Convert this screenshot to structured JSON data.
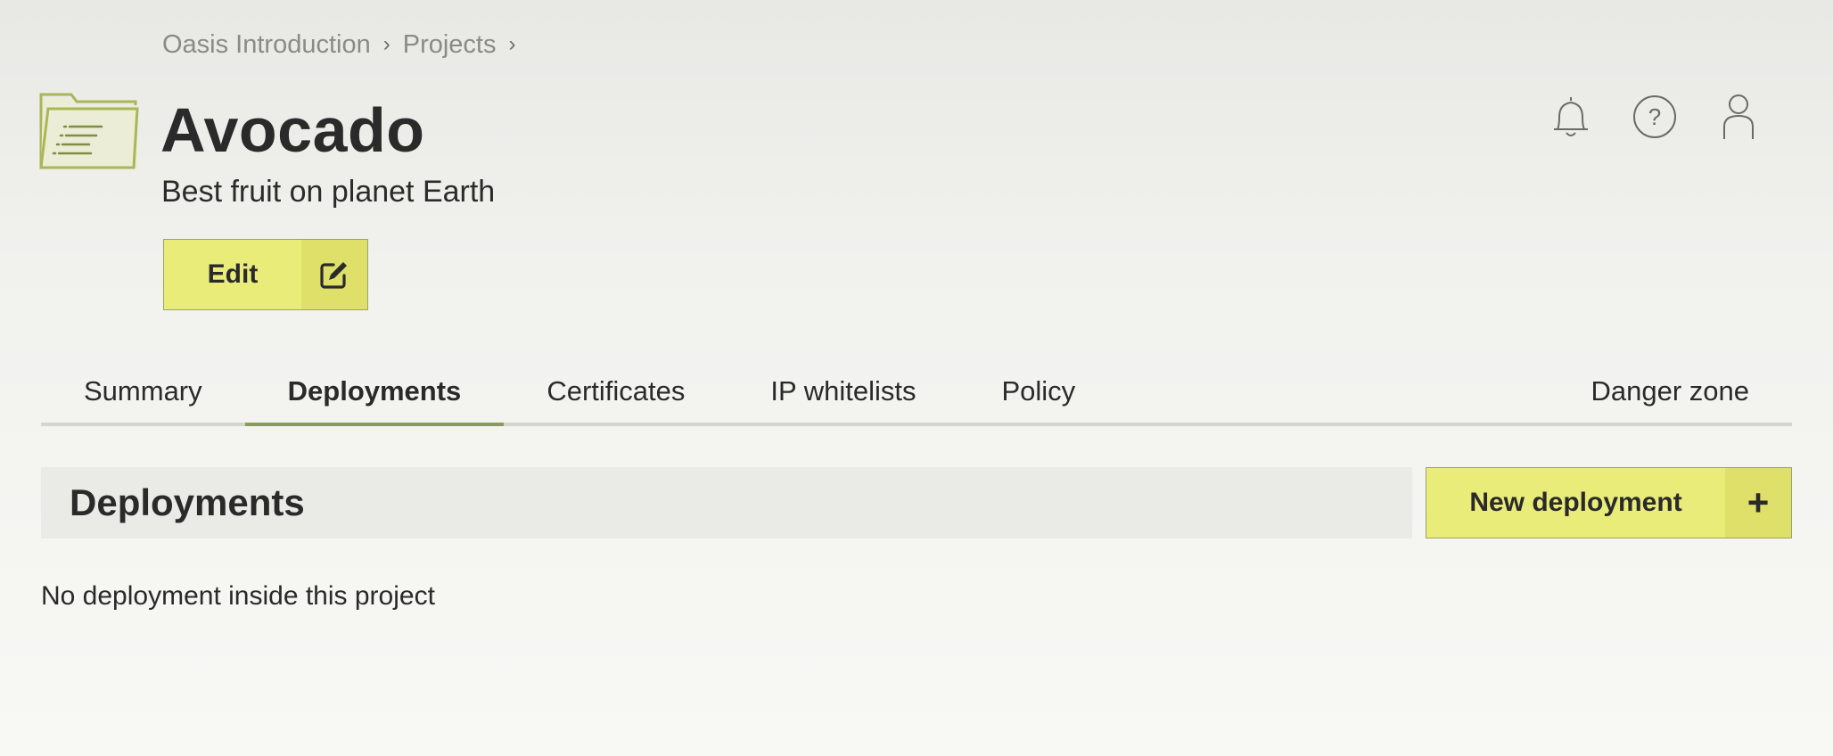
{
  "breadcrumb": {
    "items": [
      "Oasis Introduction",
      "Projects"
    ],
    "separator": "›"
  },
  "project": {
    "title": "Avocado",
    "subtitle": "Best fruit on planet Earth",
    "edit_label": "Edit"
  },
  "icons": {
    "project": "folder-icon",
    "edit": "edit-icon",
    "notifications": "bell-icon",
    "help": "help-icon",
    "account": "user-icon",
    "add": "plus-icon"
  },
  "tabs": [
    {
      "label": "Summary",
      "active": false
    },
    {
      "label": "Deployments",
      "active": true
    },
    {
      "label": "Certificates",
      "active": false
    },
    {
      "label": "IP whitelists",
      "active": false
    },
    {
      "label": "Policy",
      "active": false
    },
    {
      "label": "Danger zone",
      "active": false
    }
  ],
  "section": {
    "title": "Deployments",
    "new_button_label": "New deployment",
    "new_button_icon": "+",
    "empty_message": "No deployment inside this project"
  },
  "colors": {
    "button_bg": "#eaec7a",
    "button_icon_bg": "#dfe06a",
    "active_tab_underline": "#8a9a5a",
    "folder_stroke": "#a9b755"
  }
}
